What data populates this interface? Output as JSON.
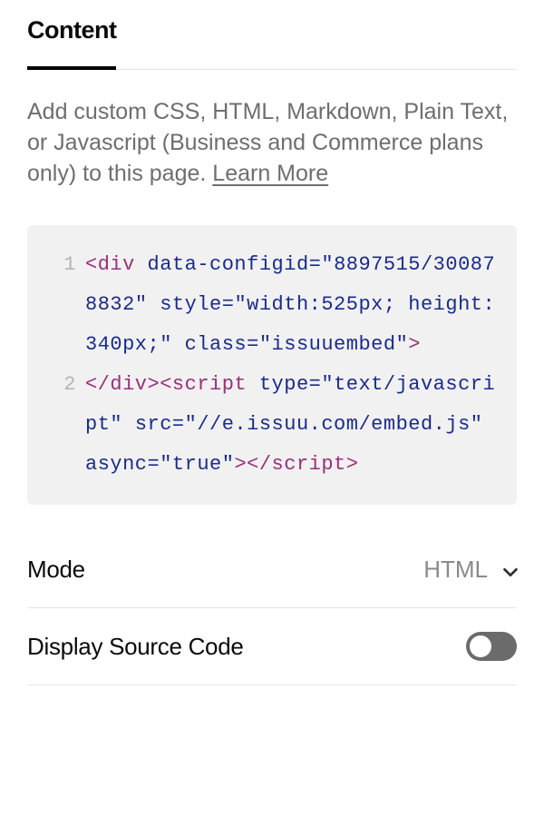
{
  "tab": {
    "label": "Content"
  },
  "description": {
    "text": "Add custom CSS, HTML, Markdown, Plain Text, or Javascript (Business and Commerce plans only) to this page. ",
    "link_label": "Learn More"
  },
  "code": {
    "line1": {
      "gutter": "1",
      "open_tag": "<div",
      "attrs": [
        {
          "name": "data-configid",
          "eq": "=",
          "q": "\"",
          "value": "8897515/300878832"
        },
        {
          "name": "style",
          "eq": "=",
          "q": "\"",
          "value": "width:525px; height:340px;"
        },
        {
          "name": "class",
          "eq": "=",
          "q": "\"",
          "value": "issuuembed"
        }
      ],
      "close": ">"
    },
    "line2": {
      "gutter": "2",
      "div_close": "</div>",
      "script_open": "<script",
      "attrs": [
        {
          "name": "type",
          "eq": "=",
          "q": "\"",
          "value": "text/javascript"
        },
        {
          "name": "src",
          "eq": "=",
          "q": "\"",
          "value": "//e.issuu.com/embed.js"
        },
        {
          "name": "async",
          "eq": "=",
          "q": "\"",
          "value": "true"
        }
      ],
      "script_close_open": ">",
      "script_close": "</script>"
    }
  },
  "mode": {
    "label": "Mode",
    "value": "HTML"
  },
  "display_source": {
    "label": "Display Source Code",
    "on": false
  }
}
